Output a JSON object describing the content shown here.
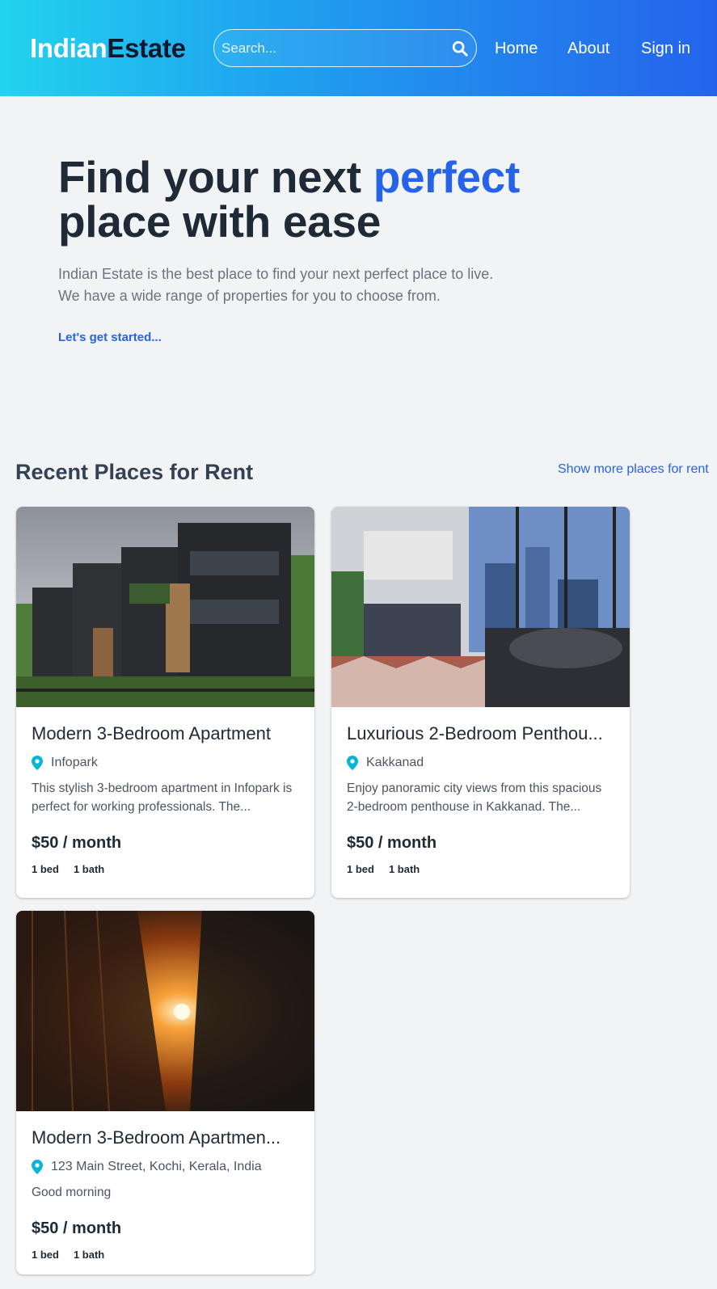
{
  "header": {
    "logo_part1": "Indian",
    "logo_part2": "Estate",
    "search_placeholder": "Search...",
    "search_icon": "search-icon",
    "nav": {
      "home": "Home",
      "about": "About",
      "signin": "Sign in"
    },
    "gradient_colors": [
      "#22d3ee",
      "#2563eb"
    ]
  },
  "hero": {
    "title_part1": "Find your next ",
    "title_accent": "perfect",
    "title_part2": "place with ease",
    "subtitle_line1": "Indian Estate is the best place to find your next perfect place to live.",
    "subtitle_line2": "We have a wide range of properties for you to choose from.",
    "cta": "Let's get started...",
    "accent_color": "#2563eb"
  },
  "listings": {
    "section_title": "Recent Places for Rent",
    "show_more": "Show more places for rent",
    "cards": [
      {
        "title": "Modern 3-Bedroom Apartment",
        "location": "Infopark",
        "description": "This stylish 3-bedroom apartment in Infopark is perfect for working professionals. The...",
        "price": "$50 / month",
        "beds": "1 bed",
        "baths": "1 bath",
        "image": "modern-apartment-building-photo"
      },
      {
        "title": "Luxurious 2-Bedroom Penthou...",
        "location": "Kakkanad",
        "description": "Enjoy panoramic city views from this spacious 2-bedroom penthouse in Kakkanad. The...",
        "price": "$50 / month",
        "beds": "1 bed",
        "baths": "1 bath",
        "image": "penthouse-interior-photo"
      },
      {
        "title": "Modern 3-Bedroom Apartmen...",
        "location": "123 Main Street, Kochi, Kerala, India",
        "description": "Good morning",
        "price": "$50 / month",
        "beds": "1 bed",
        "baths": "1 bath",
        "image": "city-sunset-street-photo"
      }
    ],
    "location_icon": "map-pin-icon",
    "pin_color": "#06b6d4"
  }
}
